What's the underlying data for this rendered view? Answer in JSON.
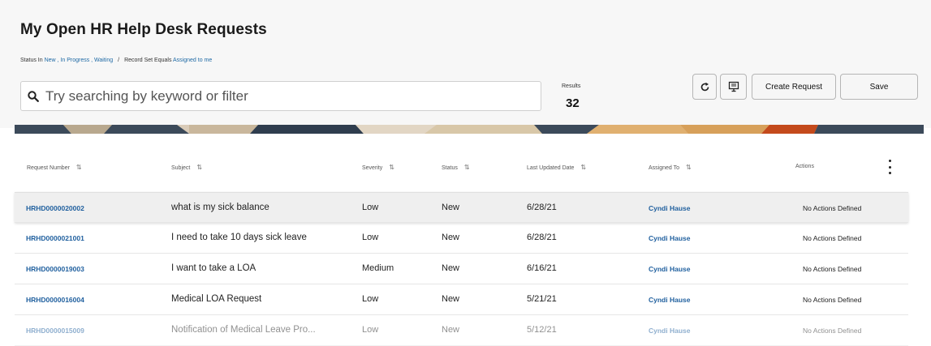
{
  "page": {
    "title": "My Open HR Help Desk Requests",
    "filter": {
      "prefix": "Status In ",
      "statuses": "New , In Progress , Waiting",
      "separator": "/",
      "record_prefix": "Record Set Equals ",
      "record_value": "Assigned to me"
    }
  },
  "search": {
    "placeholder": "Try searching by keyword or filter"
  },
  "results": {
    "label": "Results",
    "count": "32"
  },
  "toolbar": {
    "create_label": "Create Request",
    "save_label": "Save"
  },
  "colors": {
    "link": "#1f6aa5",
    "banner_dark": "#3c4a5a",
    "banner_accent": "#c44a1c"
  },
  "table": {
    "columns": [
      "Request Number",
      "Subject",
      "Severity",
      "Status",
      "Last Updated Date",
      "Assigned To",
      "Actions"
    ],
    "rows": [
      {
        "number": "HRHD0000020002",
        "subject": "what is my sick balance",
        "severity": "Low",
        "status": "New",
        "date": "6/28/21",
        "assigned": "Cyndi Hause",
        "actions": "No Actions Defined"
      },
      {
        "number": "HRHD0000021001",
        "subject": "I need to take 10 days sick leave",
        "severity": "Low",
        "status": "New",
        "date": "6/28/21",
        "assigned": "Cyndi Hause",
        "actions": "No Actions Defined"
      },
      {
        "number": "HRHD0000019003",
        "subject": "I want to take a LOA",
        "severity": "Medium",
        "status": "New",
        "date": "6/16/21",
        "assigned": "Cyndi Hause",
        "actions": "No Actions Defined"
      },
      {
        "number": "HRHD0000016004",
        "subject": "Medical LOA Request",
        "severity": "Low",
        "status": "New",
        "date": "5/21/21",
        "assigned": "Cyndi Hause",
        "actions": "No Actions Defined"
      },
      {
        "number": "HRHD0000015009",
        "subject": "Notification of Medical Leave Pro...",
        "severity": "Low",
        "status": "New",
        "date": "5/12/21",
        "assigned": "Cyndi Hause",
        "actions": "No Actions Defined"
      }
    ]
  }
}
